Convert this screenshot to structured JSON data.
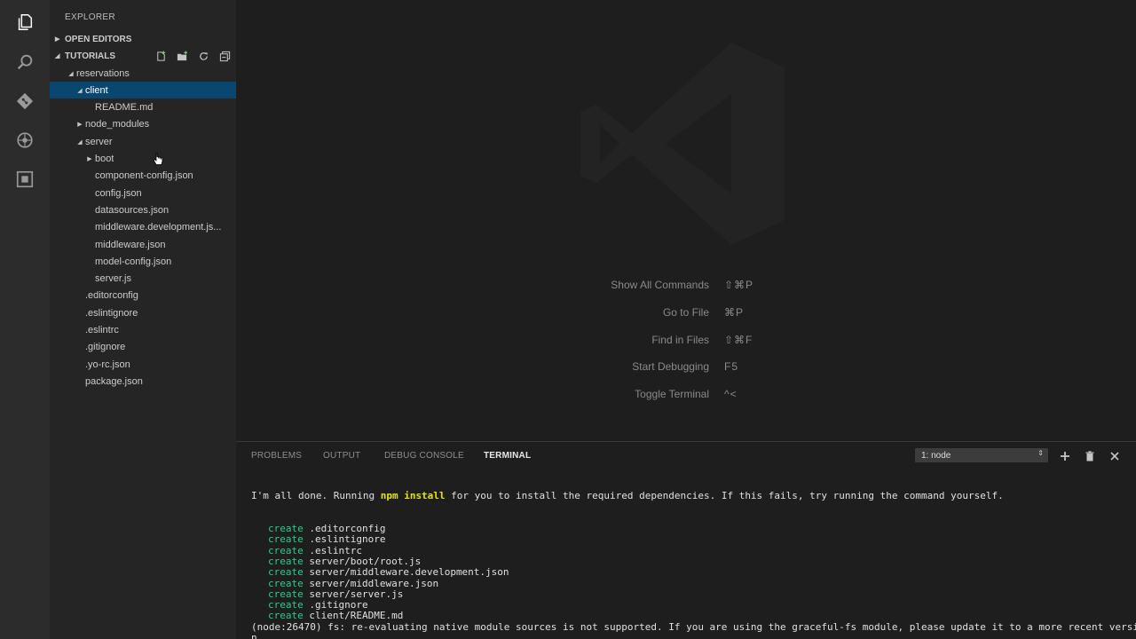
{
  "sidebar": {
    "title": "EXPLORER",
    "open_editors": "OPEN EDITORS",
    "folder": "TUTORIALS",
    "tree": [
      {
        "label": "reservations",
        "depth": 1,
        "twisty": "expanded"
      },
      {
        "label": "client",
        "depth": 2,
        "twisty": "expanded",
        "selected": true
      },
      {
        "label": "README.md",
        "depth": 3,
        "twisty": "none"
      },
      {
        "label": "node_modules",
        "depth": 2,
        "twisty": "collapsed"
      },
      {
        "label": "server",
        "depth": 2,
        "twisty": "expanded"
      },
      {
        "label": "boot",
        "depth": 3,
        "twisty": "collapsed"
      },
      {
        "label": "component-config.json",
        "depth": 3,
        "twisty": "none"
      },
      {
        "label": "config.json",
        "depth": 3,
        "twisty": "none"
      },
      {
        "label": "datasources.json",
        "depth": 3,
        "twisty": "none"
      },
      {
        "label": "middleware.development.js...",
        "depth": 3,
        "twisty": "none"
      },
      {
        "label": "middleware.json",
        "depth": 3,
        "twisty": "none"
      },
      {
        "label": "model-config.json",
        "depth": 3,
        "twisty": "none"
      },
      {
        "label": "server.js",
        "depth": 3,
        "twisty": "none"
      },
      {
        "label": ".editorconfig",
        "depth": 2,
        "twisty": "none"
      },
      {
        "label": ".eslintignore",
        "depth": 2,
        "twisty": "none"
      },
      {
        "label": ".eslintrc",
        "depth": 2,
        "twisty": "none"
      },
      {
        "label": ".gitignore",
        "depth": 2,
        "twisty": "none"
      },
      {
        "label": ".yo-rc.json",
        "depth": 2,
        "twisty": "none"
      },
      {
        "label": "package.json",
        "depth": 2,
        "twisty": "none"
      }
    ]
  },
  "editor": {
    "shortcuts": [
      {
        "label": "Show All Commands",
        "keys": "⇧⌘P"
      },
      {
        "label": "Go to File",
        "keys": "⌘P"
      },
      {
        "label": "Find in Files",
        "keys": "⇧⌘F"
      },
      {
        "label": "Start Debugging",
        "keys": "F5"
      },
      {
        "label": "Toggle Terminal",
        "keys": "^<"
      }
    ]
  },
  "panel": {
    "tabs": [
      "PROBLEMS",
      "OUTPUT",
      "DEBUG CONSOLE",
      "TERMINAL"
    ],
    "active_tab": "TERMINAL",
    "terminal_selector": "1: node",
    "terminal": {
      "intro_before": "I'm all done. Running ",
      "intro_cmd": "npm install",
      "intro_after": " for you to install the required dependencies. If this fails, try running the command yourself.",
      "create_keyword": "create",
      "created_files": [
        ".editorconfig",
        ".eslintignore",
        ".eslintrc",
        "server/boot/root.js",
        "server/middleware.development.json",
        "server/middleware.json",
        "server/server.js",
        ".gitignore",
        "client/README.md"
      ],
      "warning": "(node:26470) fs: re-evaluating native module sources is not supported. If you are using the graceful-fs module, please update it to a more recent versio",
      "warning_cont": "n."
    }
  },
  "colors": {
    "selection": "#094771",
    "terminal_green": "#23d18b",
    "terminal_yellow": "#e5e510"
  },
  "icons": {
    "activity_bar": [
      "files-icon",
      "search-icon",
      "git-icon",
      "debug-icon",
      "extensions-icon"
    ],
    "sidebar_actions": [
      "new-file-icon",
      "new-folder-icon",
      "refresh-icon",
      "collapse-all-icon"
    ],
    "panel_actions": [
      "add-terminal-icon",
      "trash-icon",
      "close-panel-icon"
    ]
  }
}
